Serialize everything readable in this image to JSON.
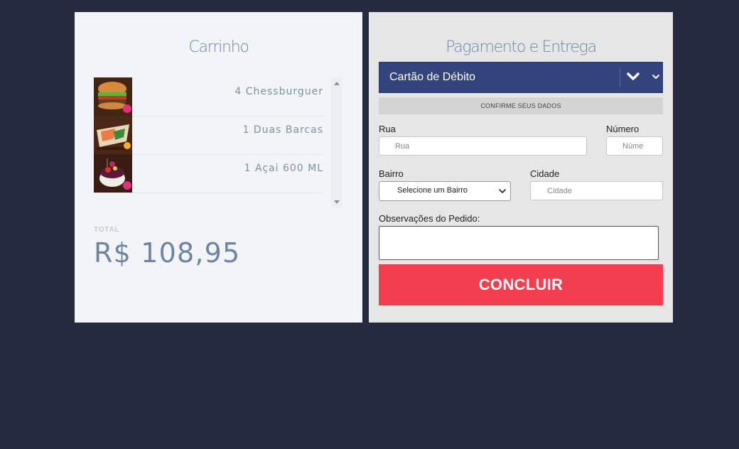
{
  "cart": {
    "title": "Carrinho",
    "items": [
      {
        "label": "4 Chessburguer",
        "image": "burger-image"
      },
      {
        "label": "1 Duas Barcas",
        "image": "sushi-boat-image"
      },
      {
        "label": "1 Açai 600 ML",
        "image": "acai-bowl-image"
      }
    ],
    "total_label": "TOTAL",
    "total_value": "R$ 108,95"
  },
  "payment": {
    "title": "Pagamento e Entrega",
    "method_selected": "Cartão de Débito",
    "confirm_label": "CONFIRME SEUS DADOS",
    "street_label": "Rua",
    "street_placeholder": "Rua",
    "number_label": "Número",
    "number_placeholder": "Núme",
    "district_label": "Bairro",
    "district_selected": "Selecione um Bairro",
    "city_label": "Cidade",
    "city_placeholder": "Cidade",
    "notes_label": "Observações do Pedido:",
    "notes_value": "",
    "submit_label": "CONCLUIR"
  },
  "colors": {
    "background": "#252a40",
    "accent_blue": "#33447c",
    "submit_red": "#f23e4e",
    "text_muted": "#6e84a4"
  }
}
